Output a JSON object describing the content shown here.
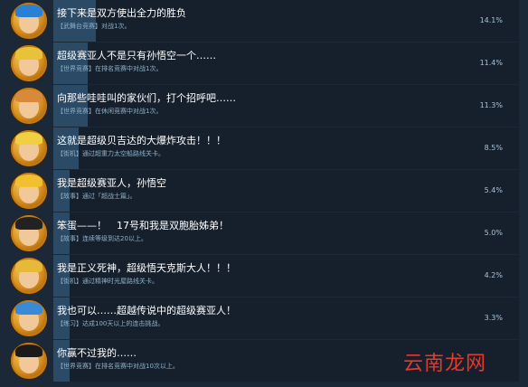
{
  "achievements": [
    {
      "title": "接下来是双方使出全力的胜负",
      "desc": "【武舞台竞赛】对战1次。",
      "percent": "14.1%",
      "fraction": 0.141,
      "hair": "#2a7fd6"
    },
    {
      "title": "超级赛亚人不是只有孙悟空一个……",
      "desc": "【世界竞赛】在排名竞赛中对战1次。",
      "percent": "11.4%",
      "fraction": 0.114,
      "hair": "#e8c23a"
    },
    {
      "title": "向那些哇哇叫的家伙们，打个招呼吧……",
      "desc": "【世界竞赛】在休闲竞赛中对战1次。",
      "percent": "11.3%",
      "fraction": 0.113,
      "hair": "#d88a3a"
    },
    {
      "title": "这就是超级贝吉达的大爆炸攻击！！！",
      "desc": "【街机】通过超重力太空船路线关卡。",
      "percent": "8.5%",
      "fraction": 0.085,
      "hair": "#f0d040"
    },
    {
      "title": "我是超级赛亚人，孙悟空",
      "desc": "【故事】通过「超战士篇」。",
      "percent": "5.4%",
      "fraction": 0.054,
      "hair": "#f0c030"
    },
    {
      "title": "笨蛋——！　17号和我是双胞胎姊弟！",
      "desc": "【故事】连续等级到达20以上。",
      "percent": "5.0%",
      "fraction": 0.05,
      "hair": "#222222"
    },
    {
      "title": "我是正义死神，超级悟天克斯大人！！！",
      "desc": "【街机】通过精神时光屋路线关卡。",
      "percent": "4.2%",
      "fraction": 0.042,
      "hair": "#e8b83a"
    },
    {
      "title": "我也可以……超越传说中的超级赛亚人！",
      "desc": "【练习】达成100天以上的连击挑战。",
      "percent": "3.3%",
      "fraction": 0.033,
      "hair": "#3a8ad8"
    },
    {
      "title": "你赢不过我的……",
      "desc": "【世界竞赛】在排名竞赛中对战10次以上。",
      "percent": "",
      "fraction": 0.0,
      "hair": "#1a1a1a"
    }
  ],
  "watermark": {
    "text": "云南龙网",
    "mark": "ym"
  }
}
